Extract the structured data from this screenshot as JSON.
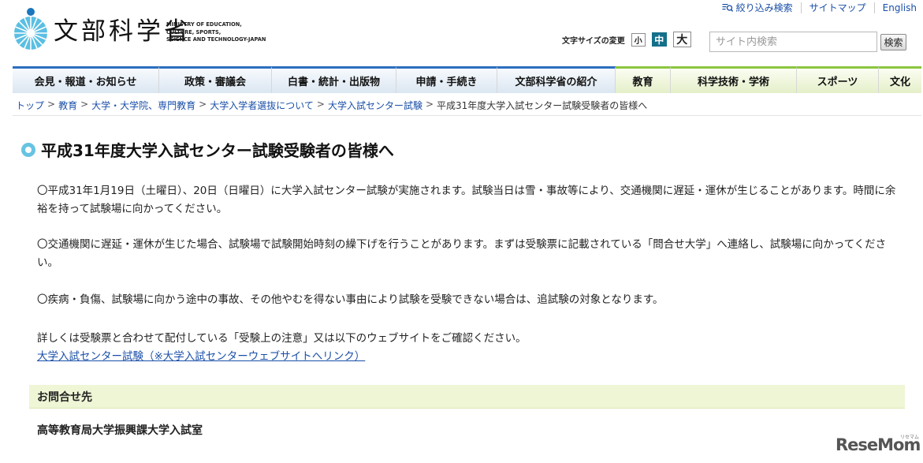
{
  "header": {
    "logo_jp": "文部科学省",
    "logo_en": [
      "MINISTRY OF EDUCATION,",
      "CULTURE, SPORTS,",
      "SCIENCE AND TECHNOLOGY-JAPAN"
    ],
    "top_links": [
      {
        "label": "絞り込み検索",
        "icon": "magnifier-list-icon"
      },
      {
        "label": "サイトマップ"
      },
      {
        "label": "English"
      }
    ],
    "font_size_label": "文字サイズの変更",
    "font_size_options": [
      "小",
      "中",
      "大"
    ],
    "font_size_selected": "中",
    "search_placeholder": "サイト内検索",
    "search_button": "検索"
  },
  "nav": {
    "items": [
      {
        "label": "会見・報道・お知らせ",
        "theme": "blue"
      },
      {
        "label": "政策・審議会",
        "theme": "blue"
      },
      {
        "label": "白書・統計・出版物",
        "theme": "blue"
      },
      {
        "label": "申請・手続き",
        "theme": "blue"
      },
      {
        "label": "文部科学省の紹介",
        "theme": "blue"
      },
      {
        "label": "教育",
        "theme": "green"
      },
      {
        "label": "科学技術・学術",
        "theme": "green"
      },
      {
        "label": "スポーツ",
        "theme": "green"
      },
      {
        "label": "文化",
        "theme": "green"
      }
    ]
  },
  "breadcrumb": {
    "items": [
      "トップ",
      "教育",
      "大学・大学院、専門教育",
      "大学入学者選抜について",
      "大学入試センター試験"
    ],
    "current": "平成31年度大学入試センター試験受験者の皆様へ",
    "separator": ">"
  },
  "main": {
    "title": "平成31年度大学入試センター試験受験者の皆様へ",
    "paragraphs": [
      "〇平成31年1月19日（土曜日）、20日（日曜日）に大学入試センター試験が実施されます。試験当日は雪・事故等により、交通機関に遅延・運休が生じることがあります。時間に余裕を持って試験場に向かってください。",
      "〇交通機関に遅延・運休が生じた場合、試験場で試験開始時刻の繰下げを行うことがあります。まずは受験票に記載されている「問合せ大学」へ連絡し、試験場に向かってください。",
      "〇疾病・負傷、試験場に向かう途中の事故、その他やむを得ない事由により試験を受験できない場合は、追試験の対象となります。",
      "詳しくは受験票と合わせて配付している「受験上の注意」又は以下のウェブサイトをご確認ください。"
    ],
    "link_label": "大学入試センター試験（※大学入試センターウェブサイトへリンク）"
  },
  "contact": {
    "heading": "お問合せ先",
    "body": "高等教育局大学振興課大学入試室"
  },
  "watermark": {
    "text": "ReseMom",
    "sub": "リセマム"
  },
  "colors": {
    "link": "#1a4fa8",
    "nav_blue_accent": "#2d6fc0",
    "nav_green_accent": "#8cc63f",
    "font_selected": "#14708a",
    "contact_bg": "#eef6d6",
    "title_bullet": "#68c3e2"
  }
}
